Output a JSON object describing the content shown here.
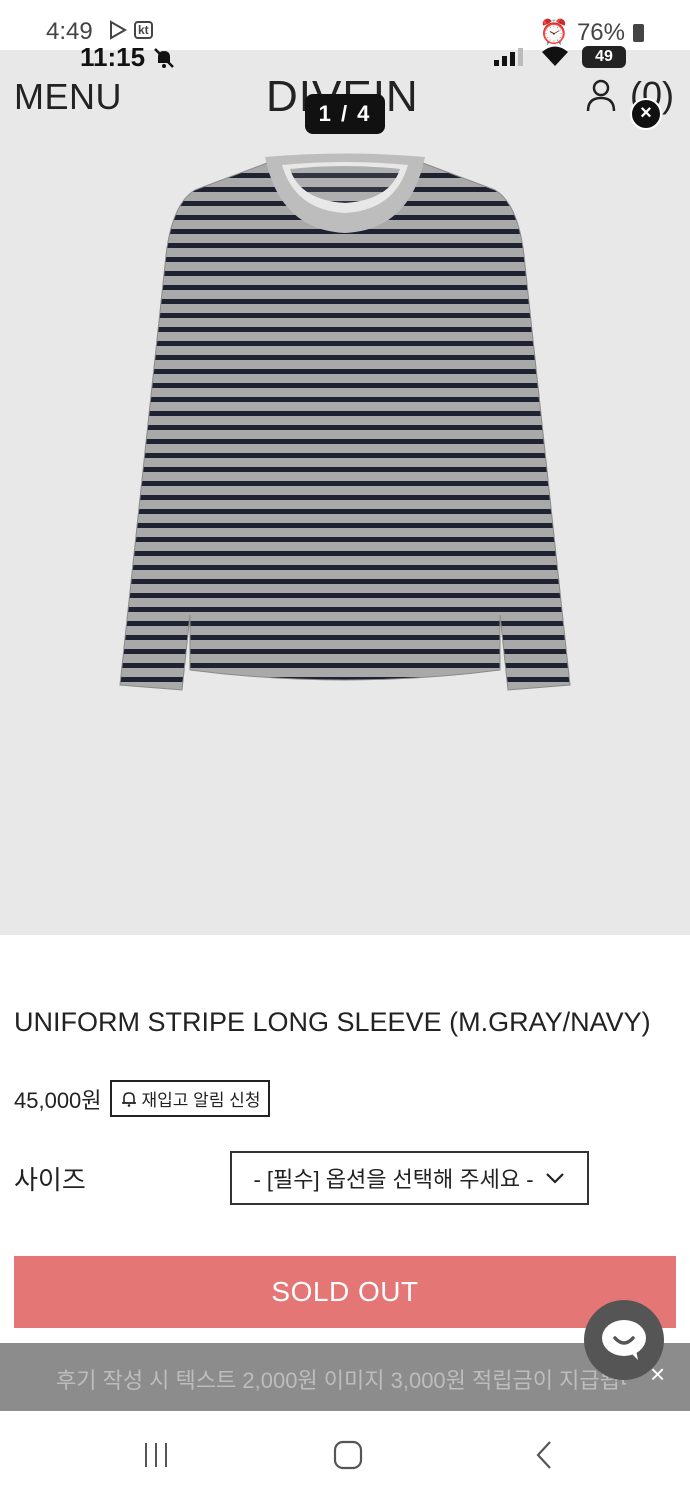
{
  "status_outer": {
    "time": "4:49",
    "kt_label": "kt",
    "battery": "76%"
  },
  "status_inner": {
    "time": "11:15",
    "battery": "49"
  },
  "header": {
    "menu": "MENU",
    "logo": "DIVEIN",
    "cart": "(0)",
    "pager": "1 / 4",
    "close": "×"
  },
  "product": {
    "title": "UNIFORM STRIPE LONG SLEEVE (M.GRAY/NAVY)",
    "price": "45,000원",
    "restock_button": "재입고 알림 신청",
    "size_label": "사이즈",
    "size_select": "- [필수] 옵션을 선택해 주세요 -",
    "sold_out": "SOLD OUT"
  },
  "promo": {
    "text": "후기 작성 시 텍스트 2,000원 이미지 3,000원 적립금이 지급됩니다",
    "close": "×"
  },
  "colors": {
    "sold_out_bg": "#e57676",
    "image_bg": "#e8e8e8",
    "stripe_navy": "#1f2230",
    "stripe_gray": "#a9a9a9"
  },
  "icons": [
    "play-store-icon",
    "bell-off-icon",
    "user-icon",
    "close-icon",
    "bell-icon",
    "chevron-down-icon",
    "chat-icon",
    "recent-apps-icon",
    "home-icon",
    "back-icon"
  ]
}
